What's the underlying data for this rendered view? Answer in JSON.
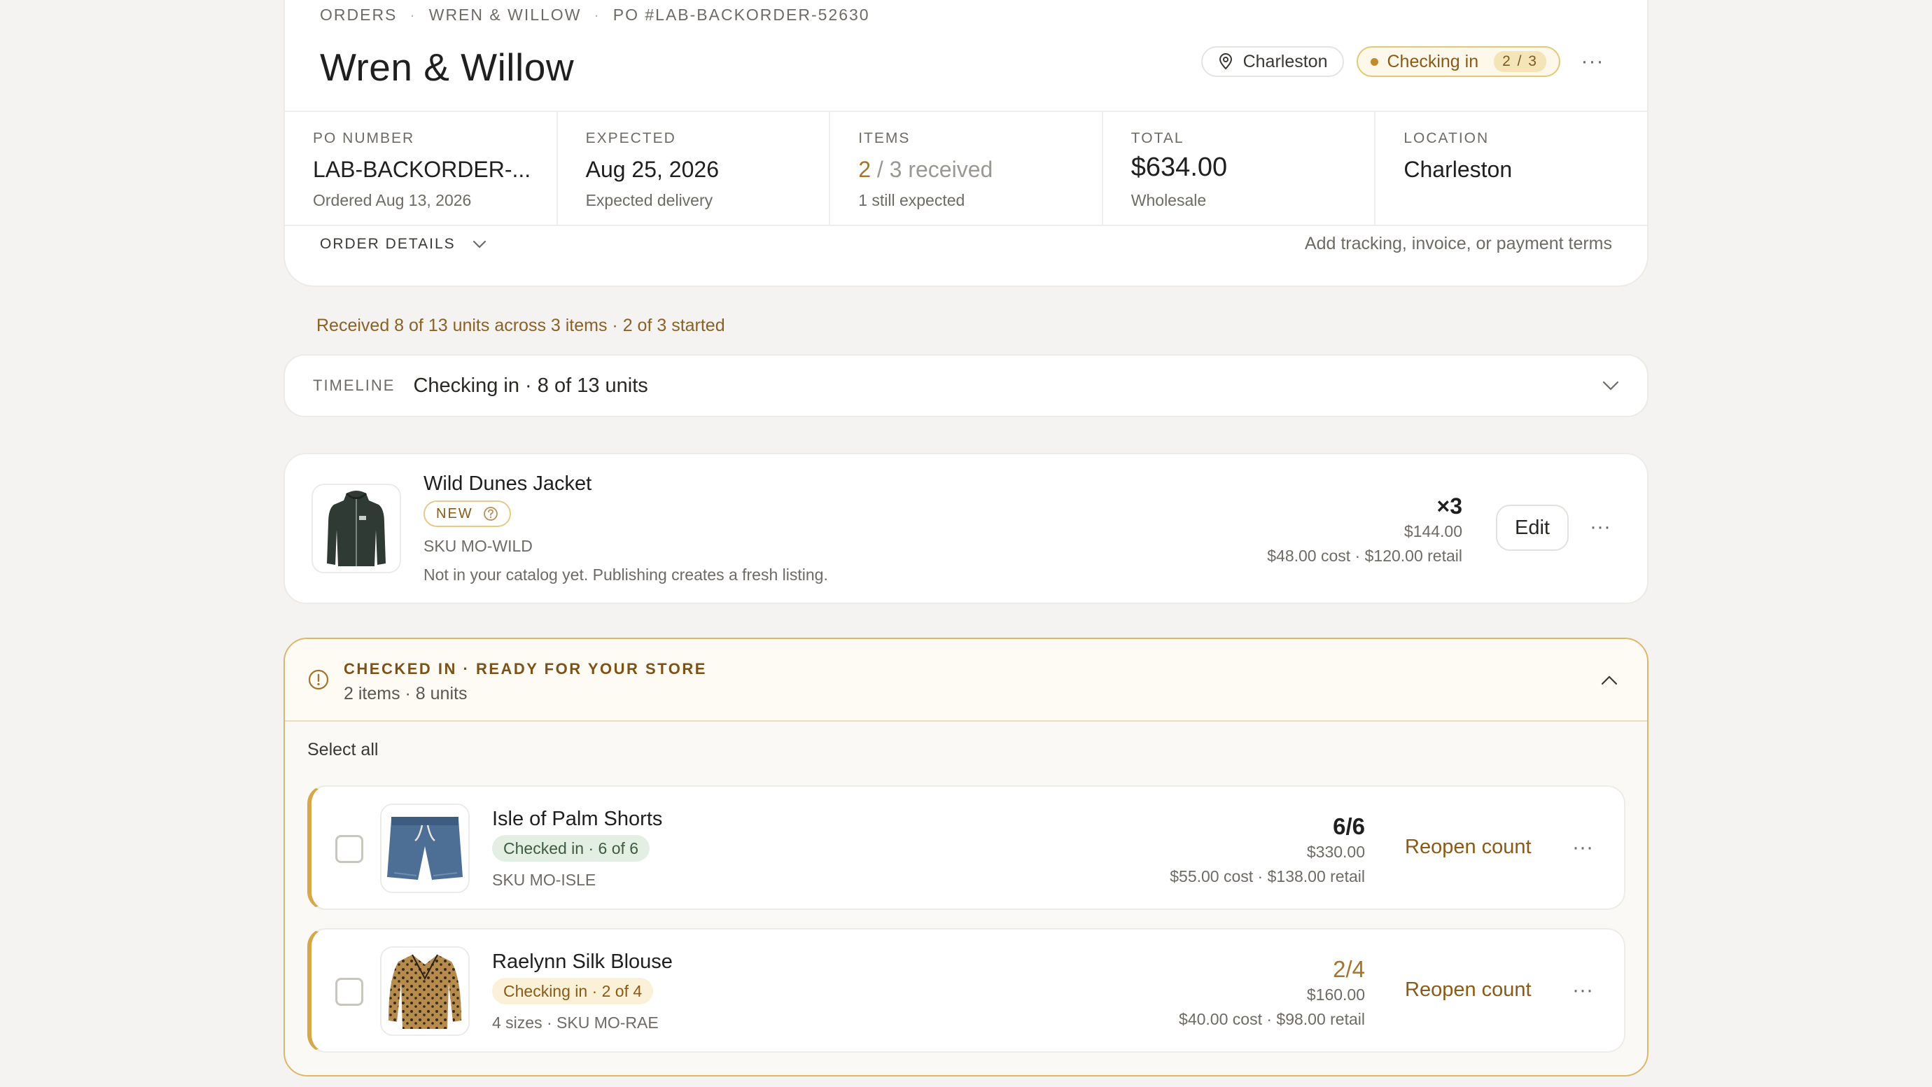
{
  "breadcrumb": [
    "ORDERS",
    "WREN & WILLOW",
    "PO #LAB-BACKORDER-52630"
  ],
  "page_title": "Wren & Willow",
  "header": {
    "location_pill": "Charleston",
    "status_label": "Checking in",
    "status_count": "2 / 3",
    "more_icon": "ellipsis-icon"
  },
  "stats": {
    "po": {
      "label": "PO NUMBER",
      "value": "LAB-BACKORDER-...",
      "sub": "Ordered Aug 13, 2026"
    },
    "expected": {
      "label": "EXPECTED",
      "value": "Aug 25, 2026",
      "sub": "Expected delivery"
    },
    "items": {
      "label": "ITEMS",
      "received": "2",
      "rest": " / 3 received",
      "sub": "1 still expected"
    },
    "total": {
      "label": "TOTAL",
      "value": "$634.00",
      "sub": "Wholesale"
    },
    "location": {
      "label": "LOCATION",
      "value": "Charleston"
    }
  },
  "order_details": {
    "label": "ORDER DETAILS",
    "hint": "Add tracking, invoice, or payment terms"
  },
  "summary_line": "Received 8 of 13 units across 3 items · 2 of 3 started",
  "timeline": {
    "label": "TIMELINE",
    "text": "Checking in · 8 of 13 units"
  },
  "pending_item": {
    "name": "Wild Dunes Jacket",
    "badge": "NEW",
    "sku": "SKU MO-WILD",
    "note": "Not in your catalog yet. Publishing creates a fresh listing.",
    "qty": "×3",
    "line_total": "$144.00",
    "unit_prices": "$48.00 cost · $120.00 retail",
    "edit_label": "Edit"
  },
  "checked_section": {
    "title": "CHECKED IN · READY FOR YOUR STORE",
    "subtitle": "2 items · 8 units",
    "select_all": "Select all",
    "items": [
      {
        "name": "Isle of Palm Shorts",
        "status": "Checked in · 6 of 6",
        "sku": "SKU MO-ISLE",
        "fraction": "6/6",
        "line_total": "$330.00",
        "unit_prices": "$55.00 cost · $138.00 retail",
        "action": "Reopen count"
      },
      {
        "name": "Raelynn Silk Blouse",
        "status": "Checking in · 2 of 4",
        "sku": "4 sizes · SKU MO-RAE",
        "fraction": "2/4",
        "line_total": "$160.00",
        "unit_prices": "$40.00 cost · $98.00 retail",
        "action": "Reopen count"
      }
    ]
  },
  "colors": {
    "accent": "#a6742b",
    "section_border": "#dcb66a",
    "background": "#f4f3f1"
  }
}
